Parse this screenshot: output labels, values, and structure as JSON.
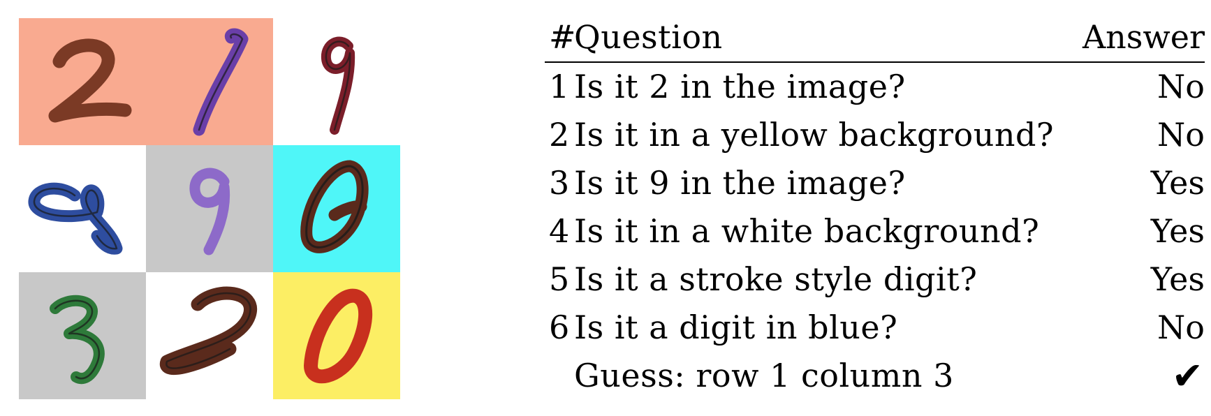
{
  "colors": {
    "salmon": "#F9AA90",
    "white": "#FFFFFF",
    "gray": "#C8C8C8",
    "cyan": "#4FF6F8",
    "yellow": "#FCEE64",
    "brown": "#7B3A25",
    "purple": "#6A3FA8",
    "maroon": "#7B1E2A",
    "blue": "#2E4D9F",
    "lavender": "#8D6AC9",
    "darkbrown": "#5A2A1C",
    "green": "#2E7A3A",
    "red": "#C8301E"
  },
  "grid": {
    "cells": [
      {
        "digit": "2",
        "bg": "#F9AA90",
        "ink": "#7B3A25"
      },
      {
        "digit": "1",
        "bg": "#F9AA90",
        "ink": "#6A3FA8"
      },
      {
        "digit": "9",
        "bg": "#FFFFFF",
        "ink": "#7B1E2A"
      },
      {
        "digit": "9",
        "bg": "#FFFFFF",
        "ink": "#2E4D9F"
      },
      {
        "digit": "9",
        "bg": "#C8C8C8",
        "ink": "#8D6AC9"
      },
      {
        "digit": "0",
        "bg": "#4FF6F8",
        "ink": "#5A2A1C"
      },
      {
        "digit": "3",
        "bg": "#C8C8C8",
        "ink": "#2E7A3A"
      },
      {
        "digit": "2",
        "bg": "#FFFFFF",
        "ink": "#5A2A1C"
      },
      {
        "digit": "0",
        "bg": "#FCEE64",
        "ink": "#C8301E"
      }
    ]
  },
  "table": {
    "header": {
      "num": "#",
      "question": "Question",
      "answer": "Answer"
    },
    "rows": [
      {
        "num": "1",
        "question": "Is it 2 in the image?",
        "answer": "No"
      },
      {
        "num": "2",
        "question": "Is it in a yellow background?",
        "answer": "No"
      },
      {
        "num": "3",
        "question": "Is it 9 in the image?",
        "answer": "Yes"
      },
      {
        "num": "4",
        "question": "Is it in a white background?",
        "answer": "Yes"
      },
      {
        "num": "5",
        "question": "Is it a stroke style digit?",
        "answer": "Yes"
      },
      {
        "num": "6",
        "question": "Is it a digit in blue?",
        "answer": "No"
      }
    ],
    "guess": {
      "text": "Guess: row 1 column 3",
      "mark": "✔",
      "mark_icon": "check-icon"
    }
  }
}
